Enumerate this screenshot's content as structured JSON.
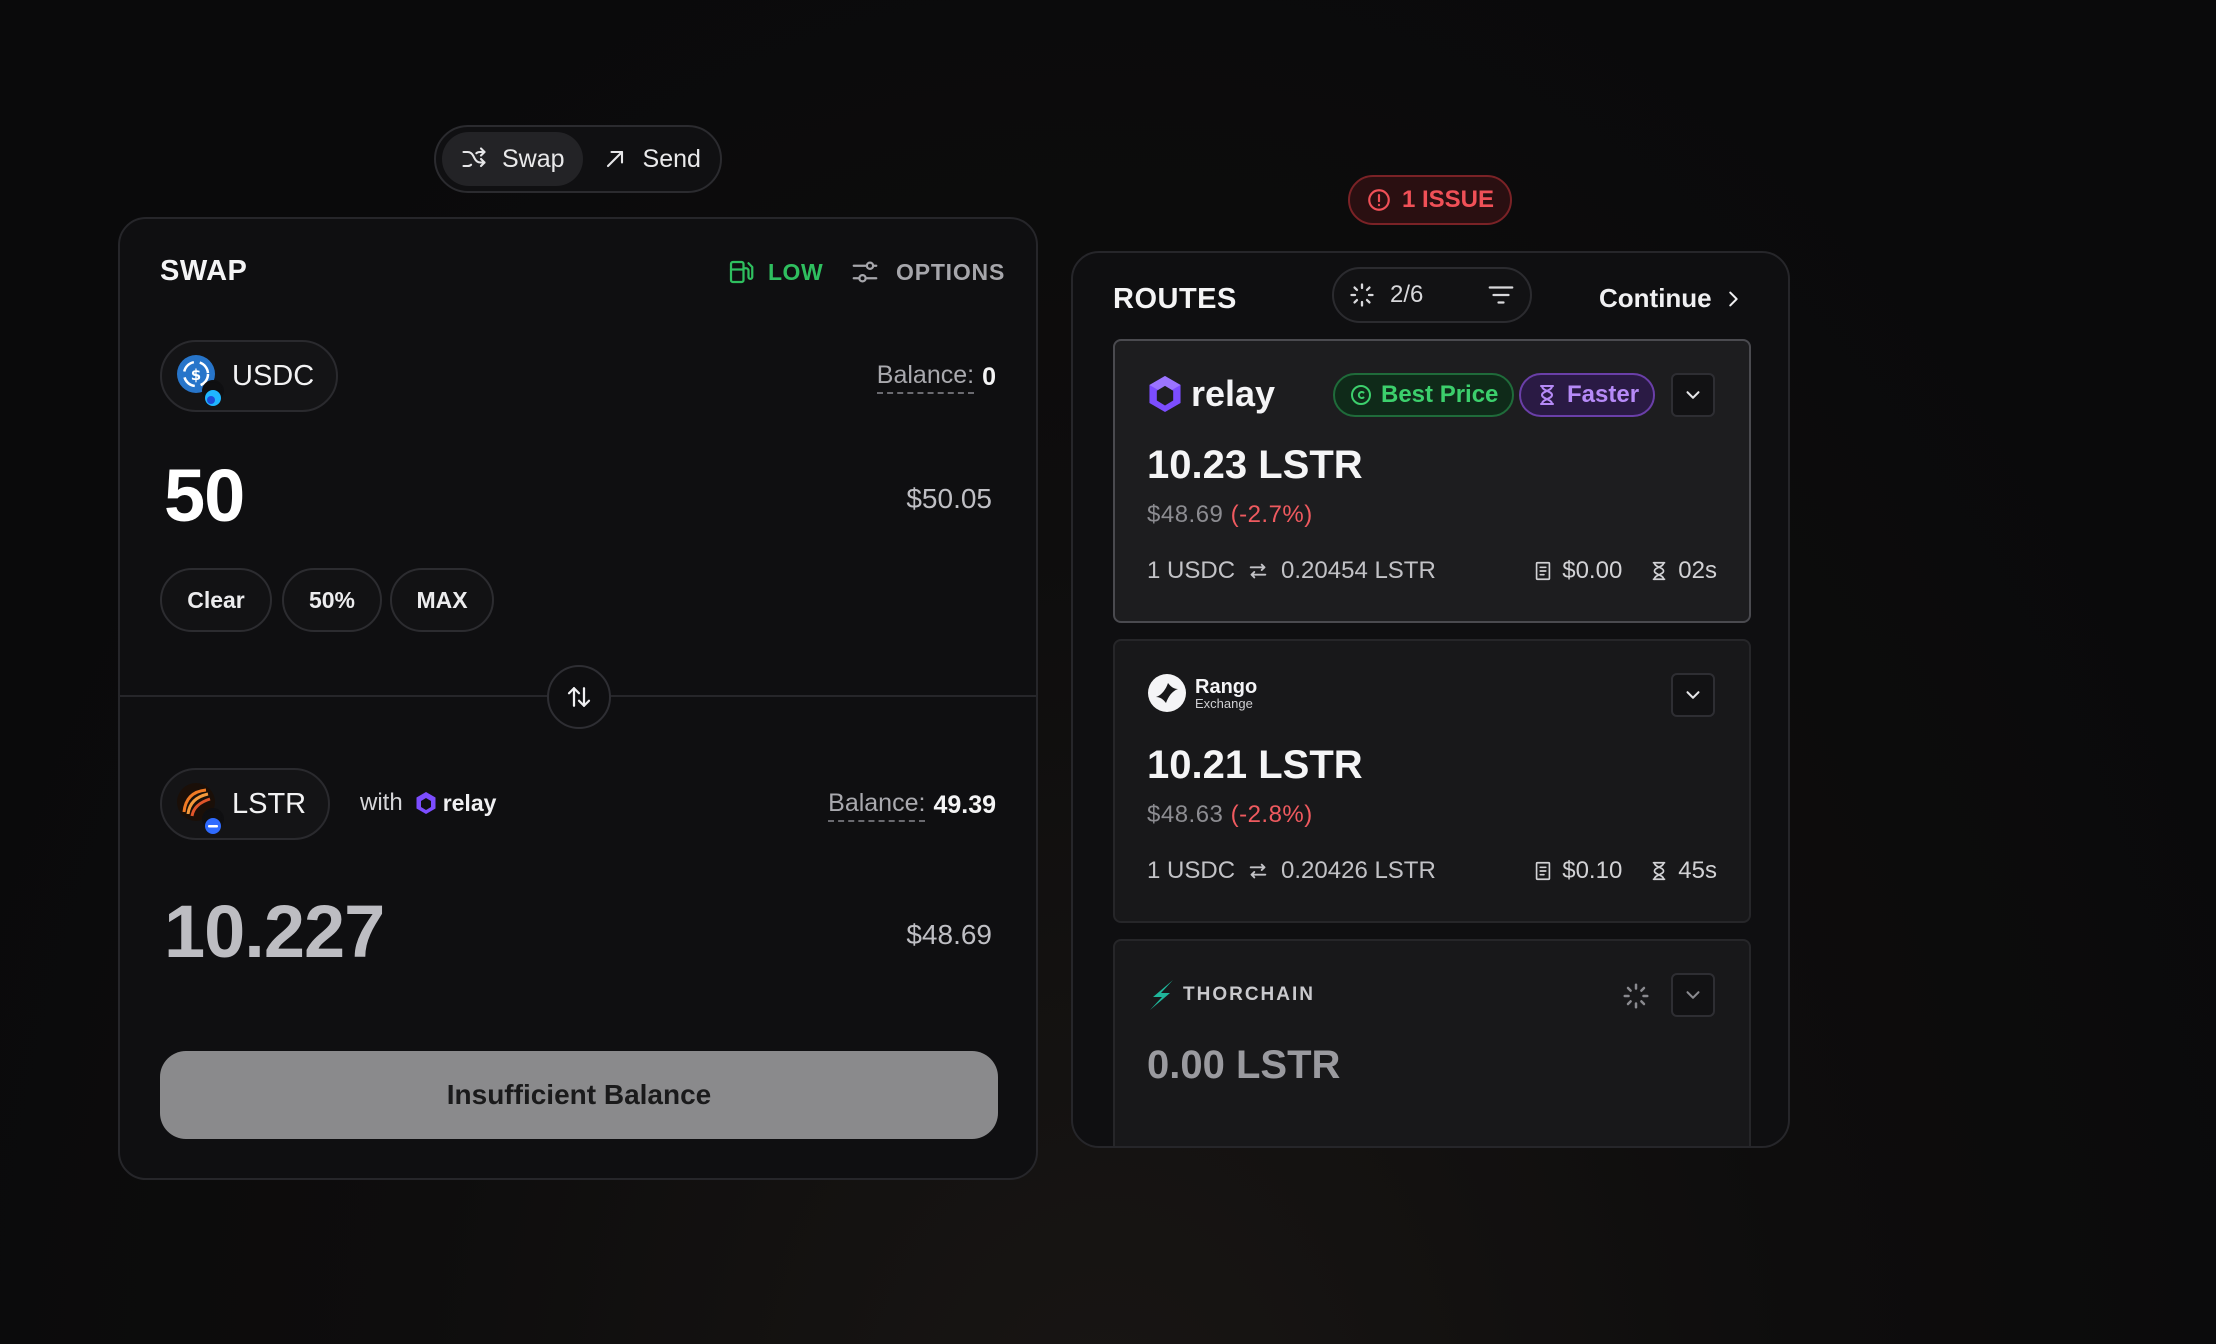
{
  "mode_toggle": {
    "swap_label": "Swap",
    "send_label": "Send",
    "active": "swap"
  },
  "swap": {
    "title": "SWAP",
    "gas_label": "LOW",
    "options_label": "OPTIONS",
    "from": {
      "token": "USDC",
      "balance_label": "Balance:",
      "balance_value": "0",
      "amount": "50",
      "usd": "$50.05"
    },
    "quick_amounts": [
      "Clear",
      "50%",
      "MAX"
    ],
    "to": {
      "token": "LSTR",
      "with_label": "with",
      "provider": "relay",
      "balance_label": "Balance:",
      "balance_value": "49.39",
      "amount": "10.227",
      "usd": "$48.69"
    },
    "cta_label": "Insufficient Balance"
  },
  "issues": {
    "label": "1 ISSUE"
  },
  "routes": {
    "title": "ROUTES",
    "progress": "2/6",
    "continue_label": "Continue",
    "items": [
      {
        "provider": "relay",
        "tags": [
          "Best Price",
          "Faster"
        ],
        "amount": "10.23 LSTR",
        "usd": "$48.69",
        "diff": "(-2.7%)",
        "rate_from": "1 USDC",
        "rate_to": "0.20454 LSTR",
        "fee": "$0.00",
        "time": "02s",
        "selected": true
      },
      {
        "provider": "Rango",
        "provider_sub": "Exchange",
        "amount": "10.21 LSTR",
        "usd": "$48.63",
        "diff": "(-2.8%)",
        "rate_from": "1 USDC",
        "rate_to": "0.20426 LSTR",
        "fee": "$0.10",
        "time": "45s",
        "selected": false
      },
      {
        "provider": "THORCHAIN",
        "amount": "0.00 LSTR",
        "loading": true
      }
    ]
  },
  "colors": {
    "accent_green": "#2fbf5f",
    "accent_purple": "#b68af7",
    "error_red": "#f05057",
    "negative": "#ef5a5f"
  }
}
